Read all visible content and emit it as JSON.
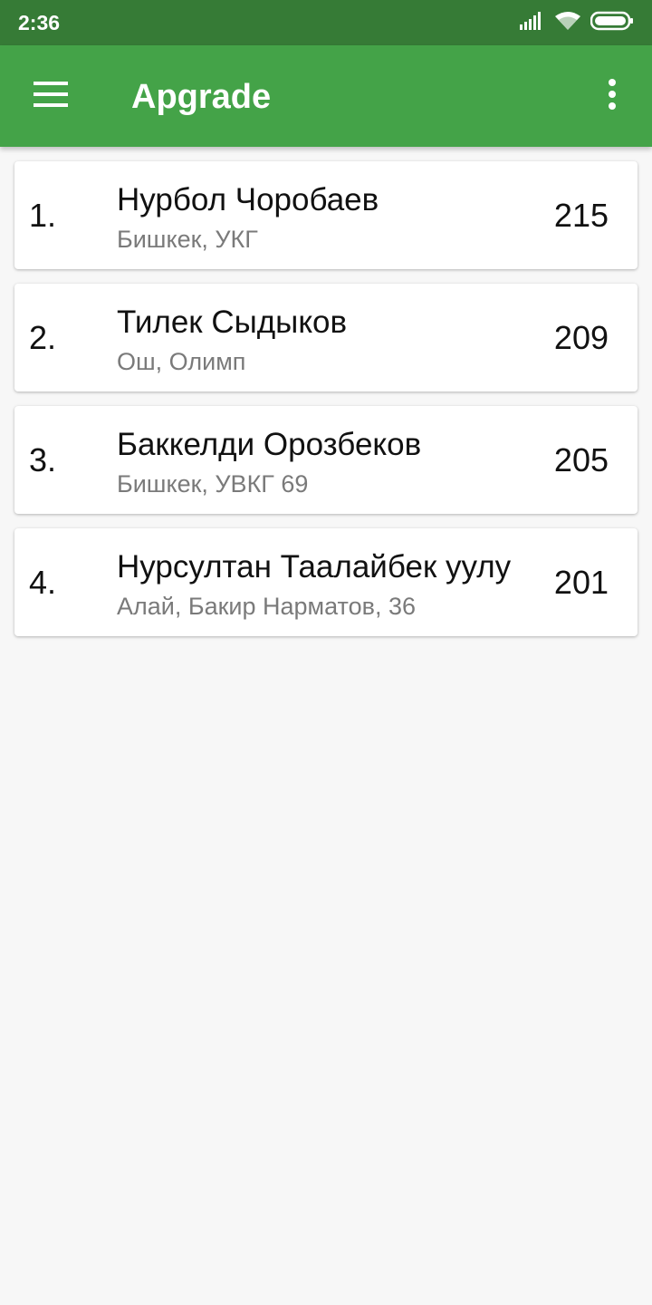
{
  "status_bar": {
    "time": "2:36",
    "icons": [
      "signal-icon",
      "wifi-icon",
      "battery-icon"
    ]
  },
  "app_bar": {
    "title": "Apgrade",
    "menu_icon": "hamburger-menu-icon",
    "overflow_icon": "more-vert-icon",
    "color": "#44a348"
  },
  "leaderboard": [
    {
      "rank": "1.",
      "name": "Нурбол Чоробаев",
      "subtitle": "Бишкек, УКГ",
      "score": "215"
    },
    {
      "rank": "2.",
      "name": "Тилек Сыдыков",
      "subtitle": "Ош, Олимп",
      "score": "209"
    },
    {
      "rank": "3.",
      "name": "Баккелди Орозбеков",
      "subtitle": "Бишкек, УВКГ 69",
      "score": "205"
    },
    {
      "rank": "4.",
      "name": "Нурсултан Таалайбек уулу",
      "subtitle": "Алай, Бакир Нарматов, 36",
      "score": "201"
    }
  ]
}
